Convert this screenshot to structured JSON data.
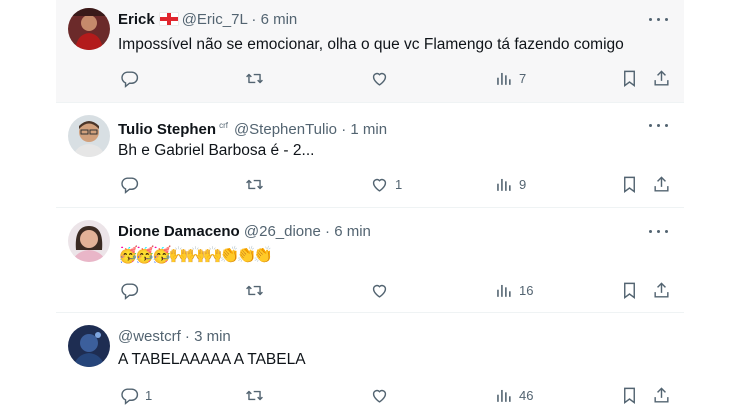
{
  "tweets": [
    {
      "name": "Erick",
      "has_flag": true,
      "handle": "@Eric_7L",
      "sep": "·",
      "time": "6 min",
      "text": "Impossível não se emocionar, olha o que vc Flamengo tá fazendo comigo",
      "replies": "",
      "retweets": "",
      "likes": "",
      "views": "7"
    },
    {
      "name": "Tulio Stephen",
      "badge": "crf",
      "handle": "@StephenTulio",
      "sep": "·",
      "time": "1 min",
      "text": "Bh e Gabriel Barbosa é - 2...",
      "replies": "",
      "retweets": "",
      "likes": "1",
      "views": "9"
    },
    {
      "name": "Dione Damaceno",
      "handle": "@26_dione",
      "sep": "·",
      "time": "6 min",
      "text": "🥳🥳🥳🙌🙌🙌👏👏👏",
      "replies": "",
      "retweets": "",
      "likes": "",
      "views": "16"
    },
    {
      "name": "",
      "handle": "@westcrf",
      "sep": "·",
      "time": "3 min",
      "text": "A TABELAAAAA A TABELA",
      "replies": "1",
      "retweets": "",
      "likes": "",
      "views": "46"
    }
  ],
  "icons": {
    "reply": "reply-icon",
    "retweet": "retweet-icon",
    "like": "heart-icon",
    "views": "views-icon",
    "bookmark": "bookmark-icon",
    "share": "share-icon",
    "more": "more-icon"
  },
  "colors": {
    "muted": "#536471",
    "text": "#0f1419",
    "highlight_bg": "#f7f7f8",
    "divider": "#eff3f4"
  }
}
